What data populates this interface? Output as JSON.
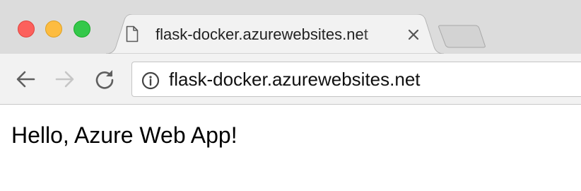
{
  "tab": {
    "title": "flask-docker.azurewebsites.net",
    "icon": "page-icon",
    "close_icon": "close-icon"
  },
  "toolbar": {
    "back_icon": "arrow-left-icon",
    "forward_icon": "arrow-right-icon",
    "reload_icon": "reload-icon"
  },
  "address_bar": {
    "icon": "info-icon",
    "url": "flask-docker.azurewebsites.net"
  },
  "page": {
    "body_text": "Hello, Azure Web App!"
  },
  "colors": {
    "traffic_close": "#fc605c",
    "traffic_minimize": "#fdbc40",
    "traffic_zoom": "#34c84a",
    "tab_strip": "#dcdcdc",
    "toolbar": "#f2f2f2"
  }
}
